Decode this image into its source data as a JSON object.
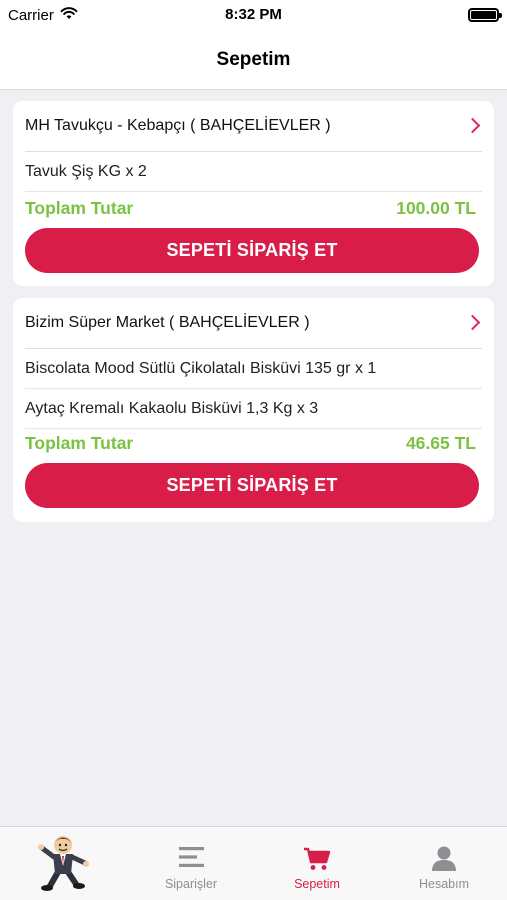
{
  "status_bar": {
    "carrier": "Carrier",
    "time": "8:32 PM"
  },
  "header": {
    "title": "Sepetim"
  },
  "carts": [
    {
      "store": "MH Tavukçu - Kebapçı ( BAHÇELİEVLER )",
      "items": [
        "Tavuk Şiş KG  x 2"
      ],
      "total_label": "Toplam Tutar",
      "total_value": "100.00 TL",
      "button_label": "SEPETİ SİPARİŞ ET"
    },
    {
      "store": "Bizim Süper Market ( BAHÇELİEVLER )",
      "items": [
        "Biscolata Mood Sütlü Çikolatalı Bisküvi 135 gr  x 1",
        "Aytaç Kremalı Kakaolu Bisküvi 1,3 Kg  x 3"
      ],
      "total_label": "Toplam Tutar",
      "total_value": "46.65 TL",
      "button_label": "SEPETİ SİPARİŞ ET"
    }
  ],
  "tab_bar": {
    "tabs": [
      {
        "label": "",
        "icon": "mascot-icon"
      },
      {
        "label": "Siparişler",
        "icon": "list-icon"
      },
      {
        "label": "Sepetim",
        "icon": "cart-icon"
      },
      {
        "label": "Hesabım",
        "icon": "person-icon"
      }
    ],
    "active_color": "#d81e48",
    "inactive_color": "#8e8e93"
  },
  "colors": {
    "accent": "#d81e48",
    "total_green": "#7dc142",
    "background": "#efeff4"
  }
}
